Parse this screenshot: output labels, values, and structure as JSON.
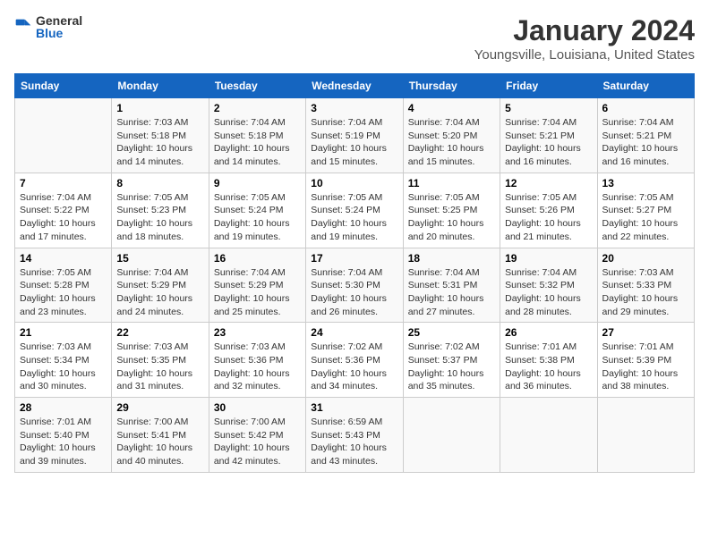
{
  "app": {
    "logo_general": "General",
    "logo_blue": "Blue"
  },
  "header": {
    "title": "January 2024",
    "location": "Youngsville, Louisiana, United States"
  },
  "weekdays": [
    "Sunday",
    "Monday",
    "Tuesday",
    "Wednesday",
    "Thursday",
    "Friday",
    "Saturday"
  ],
  "weeks": [
    [
      {
        "day": "",
        "sunrise": "",
        "sunset": "",
        "daylight": ""
      },
      {
        "day": "1",
        "sunrise": "Sunrise: 7:03 AM",
        "sunset": "Sunset: 5:18 PM",
        "daylight": "Daylight: 10 hours and 14 minutes."
      },
      {
        "day": "2",
        "sunrise": "Sunrise: 7:04 AM",
        "sunset": "Sunset: 5:18 PM",
        "daylight": "Daylight: 10 hours and 14 minutes."
      },
      {
        "day": "3",
        "sunrise": "Sunrise: 7:04 AM",
        "sunset": "Sunset: 5:19 PM",
        "daylight": "Daylight: 10 hours and 15 minutes."
      },
      {
        "day": "4",
        "sunrise": "Sunrise: 7:04 AM",
        "sunset": "Sunset: 5:20 PM",
        "daylight": "Daylight: 10 hours and 15 minutes."
      },
      {
        "day": "5",
        "sunrise": "Sunrise: 7:04 AM",
        "sunset": "Sunset: 5:21 PM",
        "daylight": "Daylight: 10 hours and 16 minutes."
      },
      {
        "day": "6",
        "sunrise": "Sunrise: 7:04 AM",
        "sunset": "Sunset: 5:21 PM",
        "daylight": "Daylight: 10 hours and 16 minutes."
      }
    ],
    [
      {
        "day": "7",
        "sunrise": "Sunrise: 7:04 AM",
        "sunset": "Sunset: 5:22 PM",
        "daylight": "Daylight: 10 hours and 17 minutes."
      },
      {
        "day": "8",
        "sunrise": "Sunrise: 7:05 AM",
        "sunset": "Sunset: 5:23 PM",
        "daylight": "Daylight: 10 hours and 18 minutes."
      },
      {
        "day": "9",
        "sunrise": "Sunrise: 7:05 AM",
        "sunset": "Sunset: 5:24 PM",
        "daylight": "Daylight: 10 hours and 19 minutes."
      },
      {
        "day": "10",
        "sunrise": "Sunrise: 7:05 AM",
        "sunset": "Sunset: 5:24 PM",
        "daylight": "Daylight: 10 hours and 19 minutes."
      },
      {
        "day": "11",
        "sunrise": "Sunrise: 7:05 AM",
        "sunset": "Sunset: 5:25 PM",
        "daylight": "Daylight: 10 hours and 20 minutes."
      },
      {
        "day": "12",
        "sunrise": "Sunrise: 7:05 AM",
        "sunset": "Sunset: 5:26 PM",
        "daylight": "Daylight: 10 hours and 21 minutes."
      },
      {
        "day": "13",
        "sunrise": "Sunrise: 7:05 AM",
        "sunset": "Sunset: 5:27 PM",
        "daylight": "Daylight: 10 hours and 22 minutes."
      }
    ],
    [
      {
        "day": "14",
        "sunrise": "Sunrise: 7:05 AM",
        "sunset": "Sunset: 5:28 PM",
        "daylight": "Daylight: 10 hours and 23 minutes."
      },
      {
        "day": "15",
        "sunrise": "Sunrise: 7:04 AM",
        "sunset": "Sunset: 5:29 PM",
        "daylight": "Daylight: 10 hours and 24 minutes."
      },
      {
        "day": "16",
        "sunrise": "Sunrise: 7:04 AM",
        "sunset": "Sunset: 5:29 PM",
        "daylight": "Daylight: 10 hours and 25 minutes."
      },
      {
        "day": "17",
        "sunrise": "Sunrise: 7:04 AM",
        "sunset": "Sunset: 5:30 PM",
        "daylight": "Daylight: 10 hours and 26 minutes."
      },
      {
        "day": "18",
        "sunrise": "Sunrise: 7:04 AM",
        "sunset": "Sunset: 5:31 PM",
        "daylight": "Daylight: 10 hours and 27 minutes."
      },
      {
        "day": "19",
        "sunrise": "Sunrise: 7:04 AM",
        "sunset": "Sunset: 5:32 PM",
        "daylight": "Daylight: 10 hours and 28 minutes."
      },
      {
        "day": "20",
        "sunrise": "Sunrise: 7:03 AM",
        "sunset": "Sunset: 5:33 PM",
        "daylight": "Daylight: 10 hours and 29 minutes."
      }
    ],
    [
      {
        "day": "21",
        "sunrise": "Sunrise: 7:03 AM",
        "sunset": "Sunset: 5:34 PM",
        "daylight": "Daylight: 10 hours and 30 minutes."
      },
      {
        "day": "22",
        "sunrise": "Sunrise: 7:03 AM",
        "sunset": "Sunset: 5:35 PM",
        "daylight": "Daylight: 10 hours and 31 minutes."
      },
      {
        "day": "23",
        "sunrise": "Sunrise: 7:03 AM",
        "sunset": "Sunset: 5:36 PM",
        "daylight": "Daylight: 10 hours and 32 minutes."
      },
      {
        "day": "24",
        "sunrise": "Sunrise: 7:02 AM",
        "sunset": "Sunset: 5:36 PM",
        "daylight": "Daylight: 10 hours and 34 minutes."
      },
      {
        "day": "25",
        "sunrise": "Sunrise: 7:02 AM",
        "sunset": "Sunset: 5:37 PM",
        "daylight": "Daylight: 10 hours and 35 minutes."
      },
      {
        "day": "26",
        "sunrise": "Sunrise: 7:01 AM",
        "sunset": "Sunset: 5:38 PM",
        "daylight": "Daylight: 10 hours and 36 minutes."
      },
      {
        "day": "27",
        "sunrise": "Sunrise: 7:01 AM",
        "sunset": "Sunset: 5:39 PM",
        "daylight": "Daylight: 10 hours and 38 minutes."
      }
    ],
    [
      {
        "day": "28",
        "sunrise": "Sunrise: 7:01 AM",
        "sunset": "Sunset: 5:40 PM",
        "daylight": "Daylight: 10 hours and 39 minutes."
      },
      {
        "day": "29",
        "sunrise": "Sunrise: 7:00 AM",
        "sunset": "Sunset: 5:41 PM",
        "daylight": "Daylight: 10 hours and 40 minutes."
      },
      {
        "day": "30",
        "sunrise": "Sunrise: 7:00 AM",
        "sunset": "Sunset: 5:42 PM",
        "daylight": "Daylight: 10 hours and 42 minutes."
      },
      {
        "day": "31",
        "sunrise": "Sunrise: 6:59 AM",
        "sunset": "Sunset: 5:43 PM",
        "daylight": "Daylight: 10 hours and 43 minutes."
      },
      {
        "day": "",
        "sunrise": "",
        "sunset": "",
        "daylight": ""
      },
      {
        "day": "",
        "sunrise": "",
        "sunset": "",
        "daylight": ""
      },
      {
        "day": "",
        "sunrise": "",
        "sunset": "",
        "daylight": ""
      }
    ]
  ]
}
